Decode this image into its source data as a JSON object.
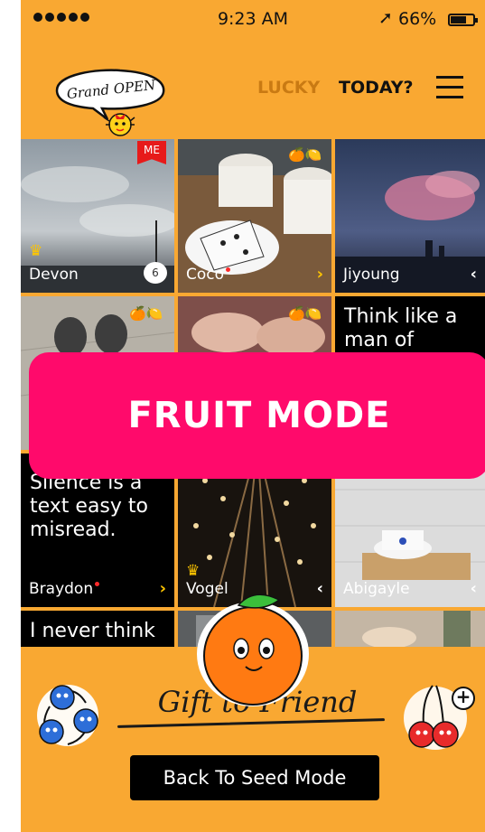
{
  "status_bar": {
    "time": "9:23 AM",
    "battery_percent": "66%",
    "battery_level": 0.66
  },
  "header": {
    "grand_open": "Grand OPEN",
    "nav": [
      {
        "label": "LUCKY",
        "active": false
      },
      {
        "label": "TODAY?",
        "active": true
      }
    ]
  },
  "grid": {
    "tiles": [
      {
        "kind": "photo",
        "name": "Devon",
        "badge": "ME",
        "comment_count": "6",
        "crown": true
      },
      {
        "kind": "photo",
        "name": "Coco",
        "new_dot": true,
        "chevron": "›",
        "fruits": "🍊🍋"
      },
      {
        "kind": "photo",
        "name": "Jiyoung",
        "chevron": "‹"
      },
      {
        "kind": "photo",
        "name": "",
        "fruits": "🍊🍋"
      },
      {
        "kind": "photo",
        "name": "",
        "fruits": "🍊🍋"
      },
      {
        "kind": "text",
        "quote": "Think like a man of action"
      },
      {
        "kind": "text",
        "quote": "Silence is a text easy to misread.",
        "name": "Braydon",
        "new_dot": true,
        "chevron": "›"
      },
      {
        "kind": "photo",
        "name": "Vogel",
        "crown": true,
        "chevron": "‹"
      },
      {
        "kind": "photo",
        "name": "Abigayle",
        "chevron": "‹"
      },
      {
        "kind": "text",
        "quote": "I never think"
      },
      {
        "kind": "photo",
        "name": ""
      },
      {
        "kind": "photo",
        "name": ""
      }
    ]
  },
  "overlay": {
    "label": "FRUIT MODE"
  },
  "bottom": {
    "gift_label": "Gift to Friend",
    "back_button": "Back To Seed Mode",
    "plus": "+"
  },
  "colors": {
    "background": "#f9a832",
    "fruit_mode": "#ff0a6b",
    "me_badge": "#e71a1a",
    "chevron_yellow": "#ffc600"
  }
}
